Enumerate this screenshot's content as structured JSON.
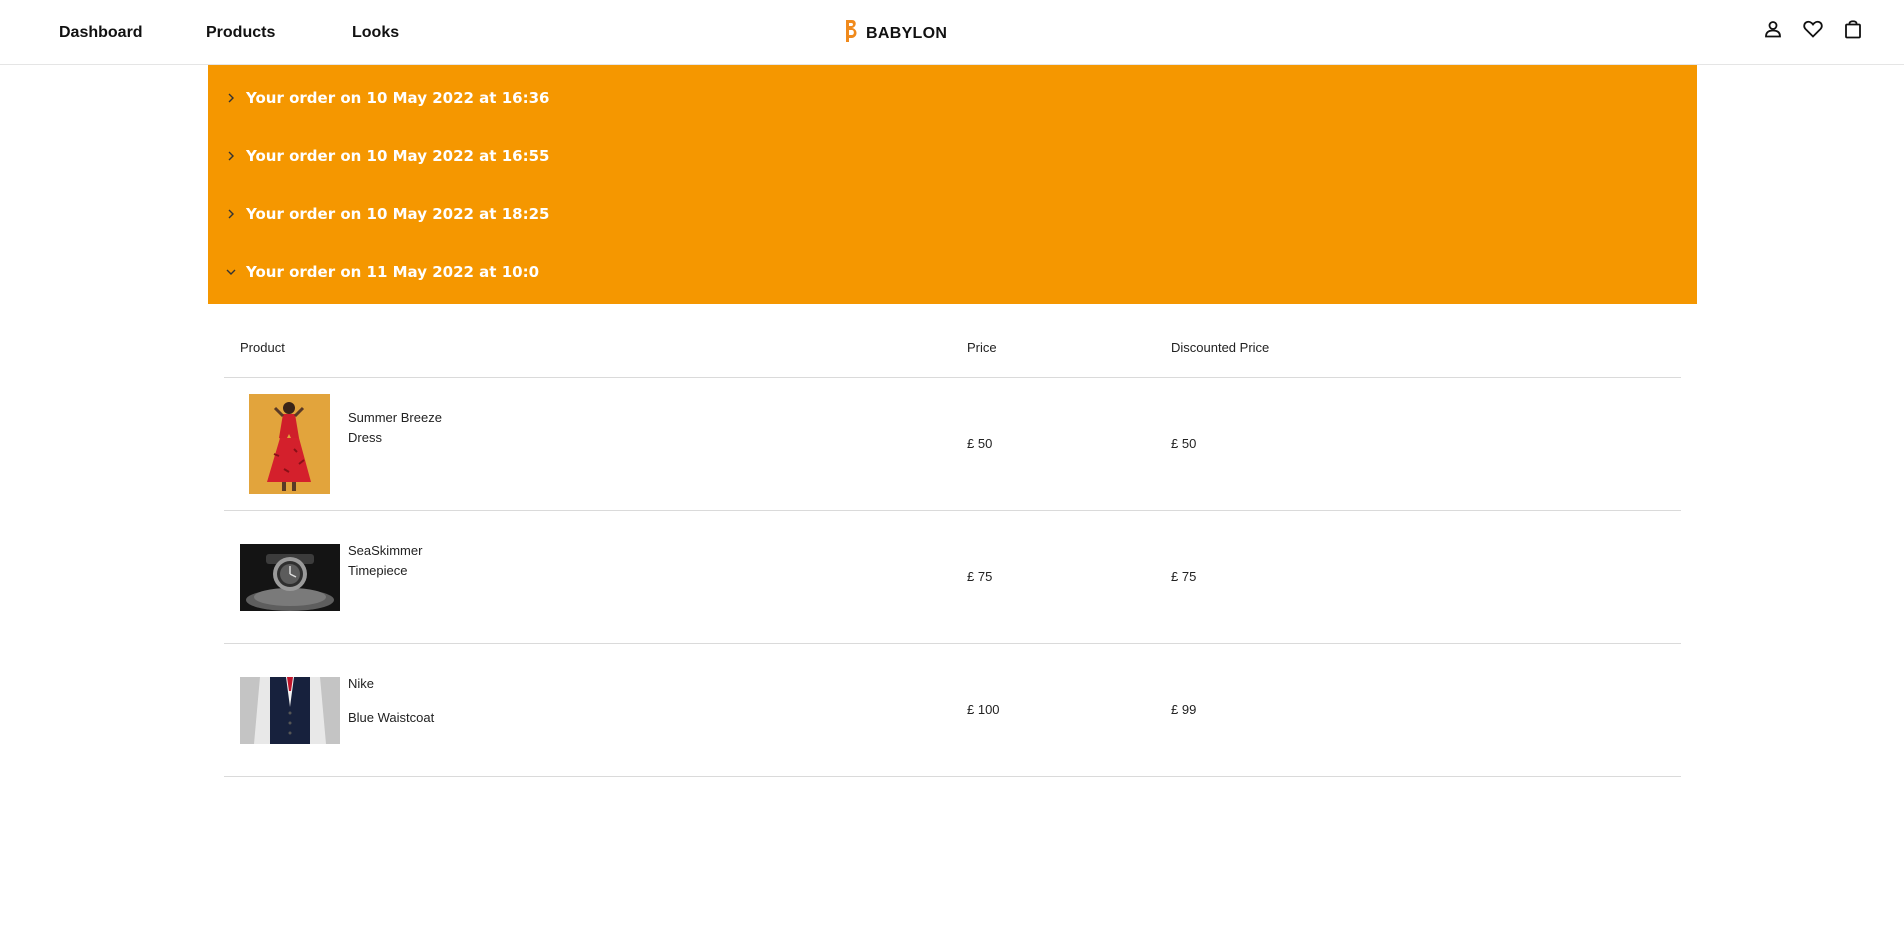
{
  "nav": {
    "dashboard": "Dashboard",
    "products": "Products",
    "looks": "Looks"
  },
  "brand": {
    "name": "BABYLON",
    "accent": "#f08a1c"
  },
  "header_icons": [
    "user-icon",
    "heart-icon",
    "shopping-bag-icon"
  ],
  "orders": {
    "color": "#f59700",
    "items": [
      {
        "label": "Your order on 10 May 2022 at 16:36",
        "expanded": false
      },
      {
        "label": "Your order on 10 May 2022 at 16:55",
        "expanded": false
      },
      {
        "label": "Your order on 10 May 2022 at 18:25",
        "expanded": false
      },
      {
        "label": "Your order on 11 May 2022 at 10:0",
        "expanded": true
      }
    ]
  },
  "table": {
    "headers": {
      "product": "Product",
      "price": "Price",
      "discounted": "Discounted Price"
    },
    "rows": [
      {
        "name_line1": "Summer Breeze",
        "name_line2": "Dress",
        "price": "£ 50",
        "discounted": "£ 50",
        "image": "red-dress-photo"
      },
      {
        "name_line1": "SeaSkimmer",
        "name_line2": "Timepiece",
        "price": "£ 75",
        "discounted": "£ 75",
        "image": "watch-photo"
      },
      {
        "name_line1": "Nike",
        "name_line2": "Blue Waistcoat",
        "price": "£ 100",
        "discounted": "£ 99",
        "image": "waistcoat-photo"
      }
    ]
  }
}
